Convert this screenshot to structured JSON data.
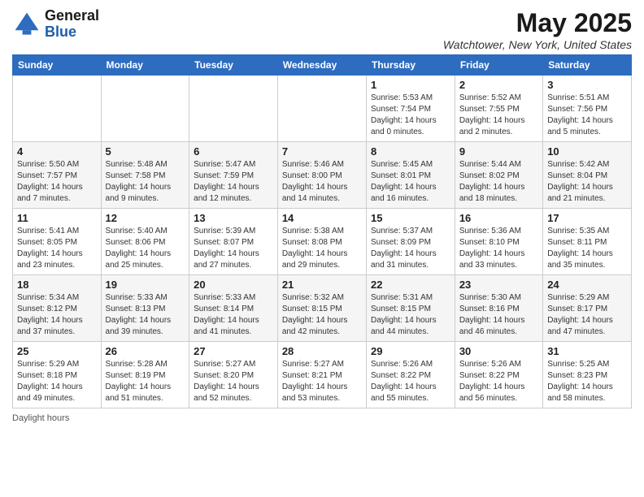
{
  "header": {
    "logo_general": "General",
    "logo_blue": "Blue",
    "month_title": "May 2025",
    "location": "Watchtower, New York, United States"
  },
  "calendar": {
    "days_of_week": [
      "Sunday",
      "Monday",
      "Tuesday",
      "Wednesday",
      "Thursday",
      "Friday",
      "Saturday"
    ],
    "weeks": [
      [
        {
          "day": "",
          "info": ""
        },
        {
          "day": "",
          "info": ""
        },
        {
          "day": "",
          "info": ""
        },
        {
          "day": "",
          "info": ""
        },
        {
          "day": "1",
          "info": "Sunrise: 5:53 AM\nSunset: 7:54 PM\nDaylight: 14 hours and 0 minutes."
        },
        {
          "day": "2",
          "info": "Sunrise: 5:52 AM\nSunset: 7:55 PM\nDaylight: 14 hours and 2 minutes."
        },
        {
          "day": "3",
          "info": "Sunrise: 5:51 AM\nSunset: 7:56 PM\nDaylight: 14 hours and 5 minutes."
        }
      ],
      [
        {
          "day": "4",
          "info": "Sunrise: 5:50 AM\nSunset: 7:57 PM\nDaylight: 14 hours and 7 minutes."
        },
        {
          "day": "5",
          "info": "Sunrise: 5:48 AM\nSunset: 7:58 PM\nDaylight: 14 hours and 9 minutes."
        },
        {
          "day": "6",
          "info": "Sunrise: 5:47 AM\nSunset: 7:59 PM\nDaylight: 14 hours and 12 minutes."
        },
        {
          "day": "7",
          "info": "Sunrise: 5:46 AM\nSunset: 8:00 PM\nDaylight: 14 hours and 14 minutes."
        },
        {
          "day": "8",
          "info": "Sunrise: 5:45 AM\nSunset: 8:01 PM\nDaylight: 14 hours and 16 minutes."
        },
        {
          "day": "9",
          "info": "Sunrise: 5:44 AM\nSunset: 8:02 PM\nDaylight: 14 hours and 18 minutes."
        },
        {
          "day": "10",
          "info": "Sunrise: 5:42 AM\nSunset: 8:04 PM\nDaylight: 14 hours and 21 minutes."
        }
      ],
      [
        {
          "day": "11",
          "info": "Sunrise: 5:41 AM\nSunset: 8:05 PM\nDaylight: 14 hours and 23 minutes."
        },
        {
          "day": "12",
          "info": "Sunrise: 5:40 AM\nSunset: 8:06 PM\nDaylight: 14 hours and 25 minutes."
        },
        {
          "day": "13",
          "info": "Sunrise: 5:39 AM\nSunset: 8:07 PM\nDaylight: 14 hours and 27 minutes."
        },
        {
          "day": "14",
          "info": "Sunrise: 5:38 AM\nSunset: 8:08 PM\nDaylight: 14 hours and 29 minutes."
        },
        {
          "day": "15",
          "info": "Sunrise: 5:37 AM\nSunset: 8:09 PM\nDaylight: 14 hours and 31 minutes."
        },
        {
          "day": "16",
          "info": "Sunrise: 5:36 AM\nSunset: 8:10 PM\nDaylight: 14 hours and 33 minutes."
        },
        {
          "day": "17",
          "info": "Sunrise: 5:35 AM\nSunset: 8:11 PM\nDaylight: 14 hours and 35 minutes."
        }
      ],
      [
        {
          "day": "18",
          "info": "Sunrise: 5:34 AM\nSunset: 8:12 PM\nDaylight: 14 hours and 37 minutes."
        },
        {
          "day": "19",
          "info": "Sunrise: 5:33 AM\nSunset: 8:13 PM\nDaylight: 14 hours and 39 minutes."
        },
        {
          "day": "20",
          "info": "Sunrise: 5:33 AM\nSunset: 8:14 PM\nDaylight: 14 hours and 41 minutes."
        },
        {
          "day": "21",
          "info": "Sunrise: 5:32 AM\nSunset: 8:15 PM\nDaylight: 14 hours and 42 minutes."
        },
        {
          "day": "22",
          "info": "Sunrise: 5:31 AM\nSunset: 8:15 PM\nDaylight: 14 hours and 44 minutes."
        },
        {
          "day": "23",
          "info": "Sunrise: 5:30 AM\nSunset: 8:16 PM\nDaylight: 14 hours and 46 minutes."
        },
        {
          "day": "24",
          "info": "Sunrise: 5:29 AM\nSunset: 8:17 PM\nDaylight: 14 hours and 47 minutes."
        }
      ],
      [
        {
          "day": "25",
          "info": "Sunrise: 5:29 AM\nSunset: 8:18 PM\nDaylight: 14 hours and 49 minutes."
        },
        {
          "day": "26",
          "info": "Sunrise: 5:28 AM\nSunset: 8:19 PM\nDaylight: 14 hours and 51 minutes."
        },
        {
          "day": "27",
          "info": "Sunrise: 5:27 AM\nSunset: 8:20 PM\nDaylight: 14 hours and 52 minutes."
        },
        {
          "day": "28",
          "info": "Sunrise: 5:27 AM\nSunset: 8:21 PM\nDaylight: 14 hours and 53 minutes."
        },
        {
          "day": "29",
          "info": "Sunrise: 5:26 AM\nSunset: 8:22 PM\nDaylight: 14 hours and 55 minutes."
        },
        {
          "day": "30",
          "info": "Sunrise: 5:26 AM\nSunset: 8:22 PM\nDaylight: 14 hours and 56 minutes."
        },
        {
          "day": "31",
          "info": "Sunrise: 5:25 AM\nSunset: 8:23 PM\nDaylight: 14 hours and 58 minutes."
        }
      ]
    ]
  },
  "footer": {
    "note": "Daylight hours"
  }
}
